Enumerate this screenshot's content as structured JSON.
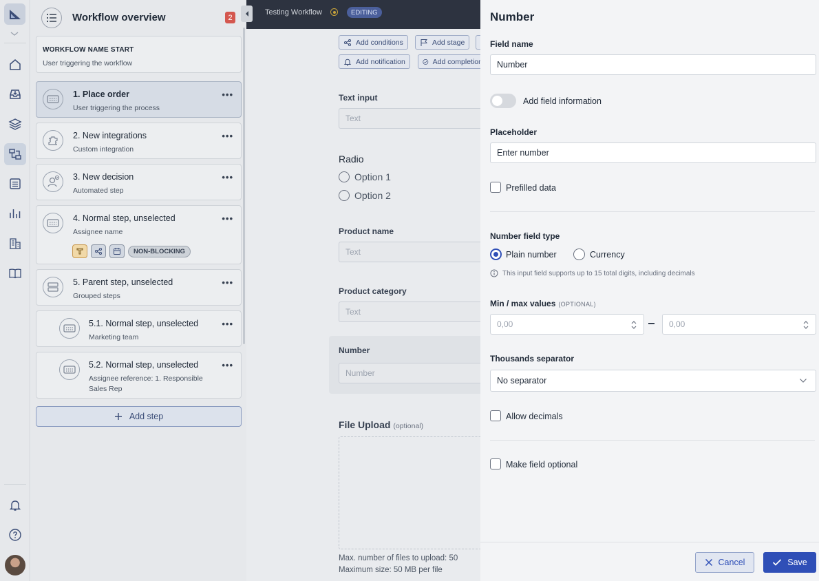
{
  "topbar": {
    "workflow_name": "Testing Workflow",
    "status_badge": "EDITING"
  },
  "sidebar": {
    "title": "Workflow overview",
    "badge_count": "2",
    "start": {
      "label": "WORKFLOW NAME START",
      "subtitle": "User triggering the workflow"
    },
    "steps": [
      {
        "title": "1. Place order",
        "subtitle": "User triggering the process",
        "icon": "step-form-icon"
      },
      {
        "title": "2. New integrations",
        "subtitle": "Custom integration",
        "icon": "puzzle-icon"
      },
      {
        "title": "3. New decision",
        "subtitle": "Automated step",
        "icon": "user-check-icon"
      },
      {
        "title": "4. Normal step, unselected",
        "subtitle": "Assignee name",
        "icon": "step-form-icon",
        "tag_label": "NON-BLOCKING"
      },
      {
        "title": "5. Parent step, unselected",
        "subtitle": "Grouped steps",
        "icon": "stack-icon"
      },
      {
        "title": "5.1. Normal step, unselected",
        "subtitle": "Marketing team",
        "icon": "step-form-icon"
      },
      {
        "title": "5.2. Normal step, unselected",
        "subtitle": "Assignee reference: 1. Responsible Sales Rep",
        "icon": "step-form-icon"
      }
    ],
    "add_step_label": "Add step",
    "more_label": "•••"
  },
  "canvas": {
    "toolbar": {
      "add_conditions": "Add conditions",
      "add_stage": "Add stage",
      "add_notification": "Add notification",
      "add_completion": "Add completion"
    },
    "fields": {
      "text_input_label": "Text input",
      "text_placeholder": "Text",
      "radio_label": "Radio",
      "option1": "Option 1",
      "option2": "Option 2",
      "product_name_label": "Product name",
      "product_category_label": "Product category",
      "number_label": "Number",
      "number_placeholder": "Number",
      "file_upload_label": "File Upload",
      "file_upload_optional": "(optional)",
      "upload_limit": "Max. number of files to upload: 50",
      "upload_size": "Maximum size: 50 MB per file"
    }
  },
  "panel": {
    "title": "Number",
    "field_name_label": "Field name",
    "field_name_value": "Number",
    "add_field_info_label": "Add field information",
    "placeholder_label": "Placeholder",
    "placeholder_value": "Enter number",
    "prefilled_label": "Prefilled data",
    "number_type_label": "Number field type",
    "type_plain": "Plain number",
    "type_currency": "Currency",
    "hint": "This input field supports up to 15 total digits, including decimals",
    "minmax_label": "Min / max values",
    "minmax_optional": "(OPTIONAL)",
    "min_placeholder": "0,00",
    "max_placeholder": "0,00",
    "thousands_label": "Thousands separator",
    "thousands_value": "No separator",
    "allow_decimals_label": "Allow decimals",
    "optional_label": "Make field optional",
    "cancel_label": "Cancel",
    "save_label": "Save"
  },
  "colors": {
    "accent": "#2f4fb7",
    "badge": "#d4574f",
    "topbar": "#2d3340"
  }
}
